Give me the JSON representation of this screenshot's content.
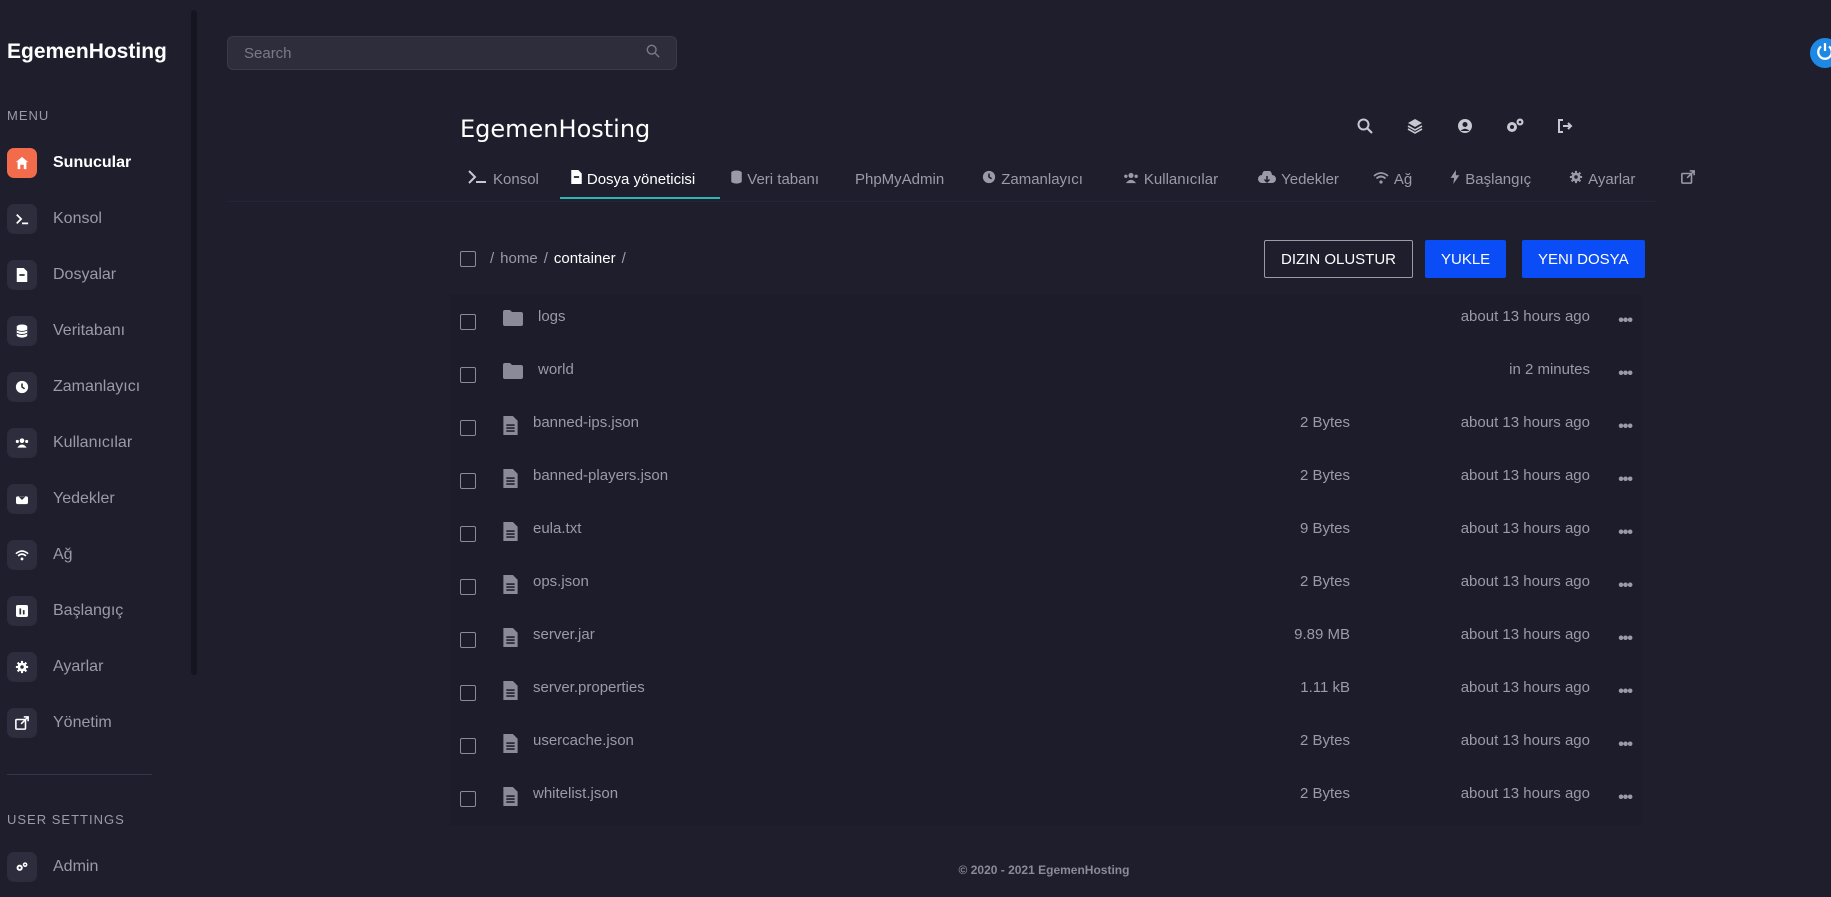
{
  "brand": "EgemenHosting",
  "sidebar": {
    "menu_label": "MENU",
    "items": [
      {
        "label": "Sunucular",
        "icon": "home-icon",
        "active": true
      },
      {
        "label": "Konsol",
        "icon": "terminal-icon"
      },
      {
        "label": "Dosyalar",
        "icon": "file-icon"
      },
      {
        "label": "Veritabanı",
        "icon": "database-icon"
      },
      {
        "label": "Zamanlayıcı",
        "icon": "clock-icon"
      },
      {
        "label": "Kullanıcılar",
        "icon": "users-icon"
      },
      {
        "label": "Yedekler",
        "icon": "backup-icon"
      },
      {
        "label": "Ağ",
        "icon": "wifi-icon"
      },
      {
        "label": "Başlangıç",
        "icon": "startup-icon"
      },
      {
        "label": "Ayarlar",
        "icon": "gear-icon"
      },
      {
        "label": "Yönetim",
        "icon": "external-link-icon"
      }
    ],
    "user_settings_label": "USER SETTINGS",
    "user_items": [
      {
        "label": "Admin",
        "icon": "admin-gears-icon"
      }
    ]
  },
  "search": {
    "placeholder": "Search",
    "value": ""
  },
  "server": {
    "title": "EgemenHosting"
  },
  "tabs": [
    {
      "label": "Konsol",
      "icon": "terminal-icon"
    },
    {
      "label": "Dosya yöneticisi",
      "icon": "file-icon",
      "active": true
    },
    {
      "label": "Veri tabanı",
      "icon": "database-icon"
    },
    {
      "label": "PhpMyAdmin",
      "icon": ""
    },
    {
      "label": "Zamanlayıcı",
      "icon": "clock-icon"
    },
    {
      "label": "Kullanıcılar",
      "icon": "users-icon"
    },
    {
      "label": "Yedekler",
      "icon": "cloud-icon"
    },
    {
      "label": "Ağ",
      "icon": "wifi-icon"
    },
    {
      "label": "Başlangıç",
      "icon": "bolt-icon"
    },
    {
      "label": "Ayarlar",
      "icon": "gear-icon"
    }
  ],
  "breadcrumb": {
    "sep": "/",
    "parts": [
      "home",
      "container"
    ]
  },
  "actions": {
    "create_dir": "DIZIN OLUSTUR",
    "upload": "YUKLE",
    "new_file": "YENI DOSYA"
  },
  "files": [
    {
      "name": "logs",
      "type": "folder",
      "size": "",
      "modified": "about 13 hours ago"
    },
    {
      "name": "world",
      "type": "folder",
      "size": "",
      "modified": "in 2 minutes"
    },
    {
      "name": "banned-ips.json",
      "type": "file",
      "size": "2 Bytes",
      "modified": "about 13 hours ago"
    },
    {
      "name": "banned-players.json",
      "type": "file",
      "size": "2 Bytes",
      "modified": "about 13 hours ago"
    },
    {
      "name": "eula.txt",
      "type": "file",
      "size": "9 Bytes",
      "modified": "about 13 hours ago"
    },
    {
      "name": "ops.json",
      "type": "file",
      "size": "2 Bytes",
      "modified": "about 13 hours ago"
    },
    {
      "name": "server.jar",
      "type": "file",
      "size": "9.89 MB",
      "modified": "about 13 hours ago"
    },
    {
      "name": "server.properties",
      "type": "file",
      "size": "1.11 kB",
      "modified": "about 13 hours ago"
    },
    {
      "name": "usercache.json",
      "type": "file",
      "size": "2 Bytes",
      "modified": "about 13 hours ago"
    },
    {
      "name": "whitelist.json",
      "type": "file",
      "size": "2 Bytes",
      "modified": "about 13 hours ago"
    }
  ],
  "footer": "© 2020 - 2021 EgemenHosting",
  "colors": {
    "accent": "#f26b4a",
    "primary": "#0a4cf5",
    "tab_underline": "#2cb5b5",
    "background": "#1e1e2d"
  }
}
